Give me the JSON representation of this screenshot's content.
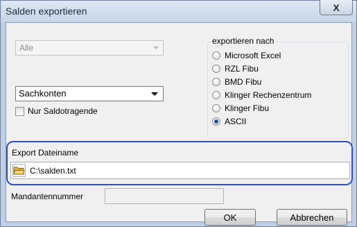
{
  "window": {
    "title": "Salden exportieren",
    "close_glyph": "X"
  },
  "left": {
    "disabled_combo_value": "Alle",
    "account_combo_value": "Sachkonten",
    "checkbox_label": "Nur Saldotragende",
    "checkbox_checked": false
  },
  "export_group": {
    "legend": "exportieren nach",
    "options": [
      {
        "label": "Microsoft Excel",
        "checked": false
      },
      {
        "label": "RZL Fibu",
        "checked": false
      },
      {
        "label": "BMD Fibu",
        "checked": false
      },
      {
        "label": "Klinger Rechenzentrum",
        "checked": false
      },
      {
        "label": "Klinger Fibu",
        "checked": false
      },
      {
        "label": "ASCII",
        "checked": true
      }
    ]
  },
  "export_file": {
    "label": "Export Dateiname",
    "value": "C:\\salden.txt",
    "folder_icon": "folder-icon"
  },
  "mandant": {
    "label": "Mandantennummer",
    "value": ""
  },
  "buttons": {
    "ok": "OK",
    "cancel": "Abbrechen"
  },
  "colors": {
    "highlight_border": "#2c4ed6",
    "radio_selected": "#1e4f9c"
  }
}
